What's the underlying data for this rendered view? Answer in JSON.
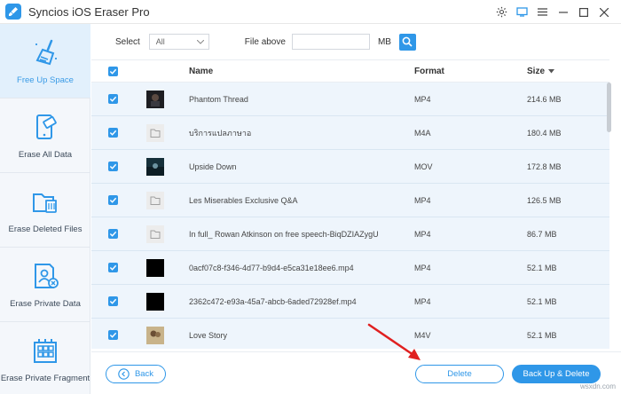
{
  "app": {
    "title": "Syncios iOS Eraser Pro"
  },
  "sidebar": {
    "items": [
      {
        "label": "Free Up Space",
        "icon": "broom-icon",
        "active": true
      },
      {
        "label": "Erase All Data",
        "icon": "phone-erase-icon"
      },
      {
        "label": "Erase Deleted Files",
        "icon": "folder-trash-icon"
      },
      {
        "label": "Erase Private Data",
        "icon": "private-data-icon"
      },
      {
        "label": "Erase Private Fragment",
        "icon": "fragment-grid-icon"
      }
    ]
  },
  "filter": {
    "select_label": "Select",
    "select_value": "All",
    "file_above_label": "File above",
    "file_above_value": "",
    "unit": "MB"
  },
  "table": {
    "columns": {
      "name": "Name",
      "format": "Format",
      "size": "Size"
    },
    "rows": [
      {
        "name": "Phantom Thread",
        "format": "MP4",
        "size": "214.6 MB",
        "thumb": "dark-poster"
      },
      {
        "name": "บริการแปลภาษาอ",
        "format": "M4A",
        "size": "180.4 MB",
        "thumb": "folder"
      },
      {
        "name": "Upside Down",
        "format": "MOV",
        "size": "172.8 MB",
        "thumb": "movie-poster"
      },
      {
        "name": "Les Miserables Exclusive Q&A",
        "format": "MP4",
        "size": "126.5 MB",
        "thumb": "folder"
      },
      {
        "name": "In full_ Rowan Atkinson on free speech-BiqDZIAZygU",
        "format": "MP4",
        "size": "86.7 MB",
        "thumb": "folder"
      },
      {
        "name": "0acf07c8-f346-4d77-b9d4-e5ca31e18ee6.mp4",
        "format": "MP4",
        "size": "52.1 MB",
        "thumb": "black"
      },
      {
        "name": "2362c472-e93a-45a7-abcb-6aded72928ef.mp4",
        "format": "MP4",
        "size": "52.1 MB",
        "thumb": "black"
      },
      {
        "name": "Love Story",
        "format": "M4V",
        "size": "52.1 MB",
        "thumb": "love-poster"
      }
    ]
  },
  "buttons": {
    "back": "Back",
    "delete": "Delete",
    "backup_delete": "Back Up & Delete"
  },
  "watermark": "wsxdn.com",
  "colors": {
    "accent": "#2f97e8",
    "row_bg": "#eef5fc",
    "arrow": "#e02020"
  }
}
